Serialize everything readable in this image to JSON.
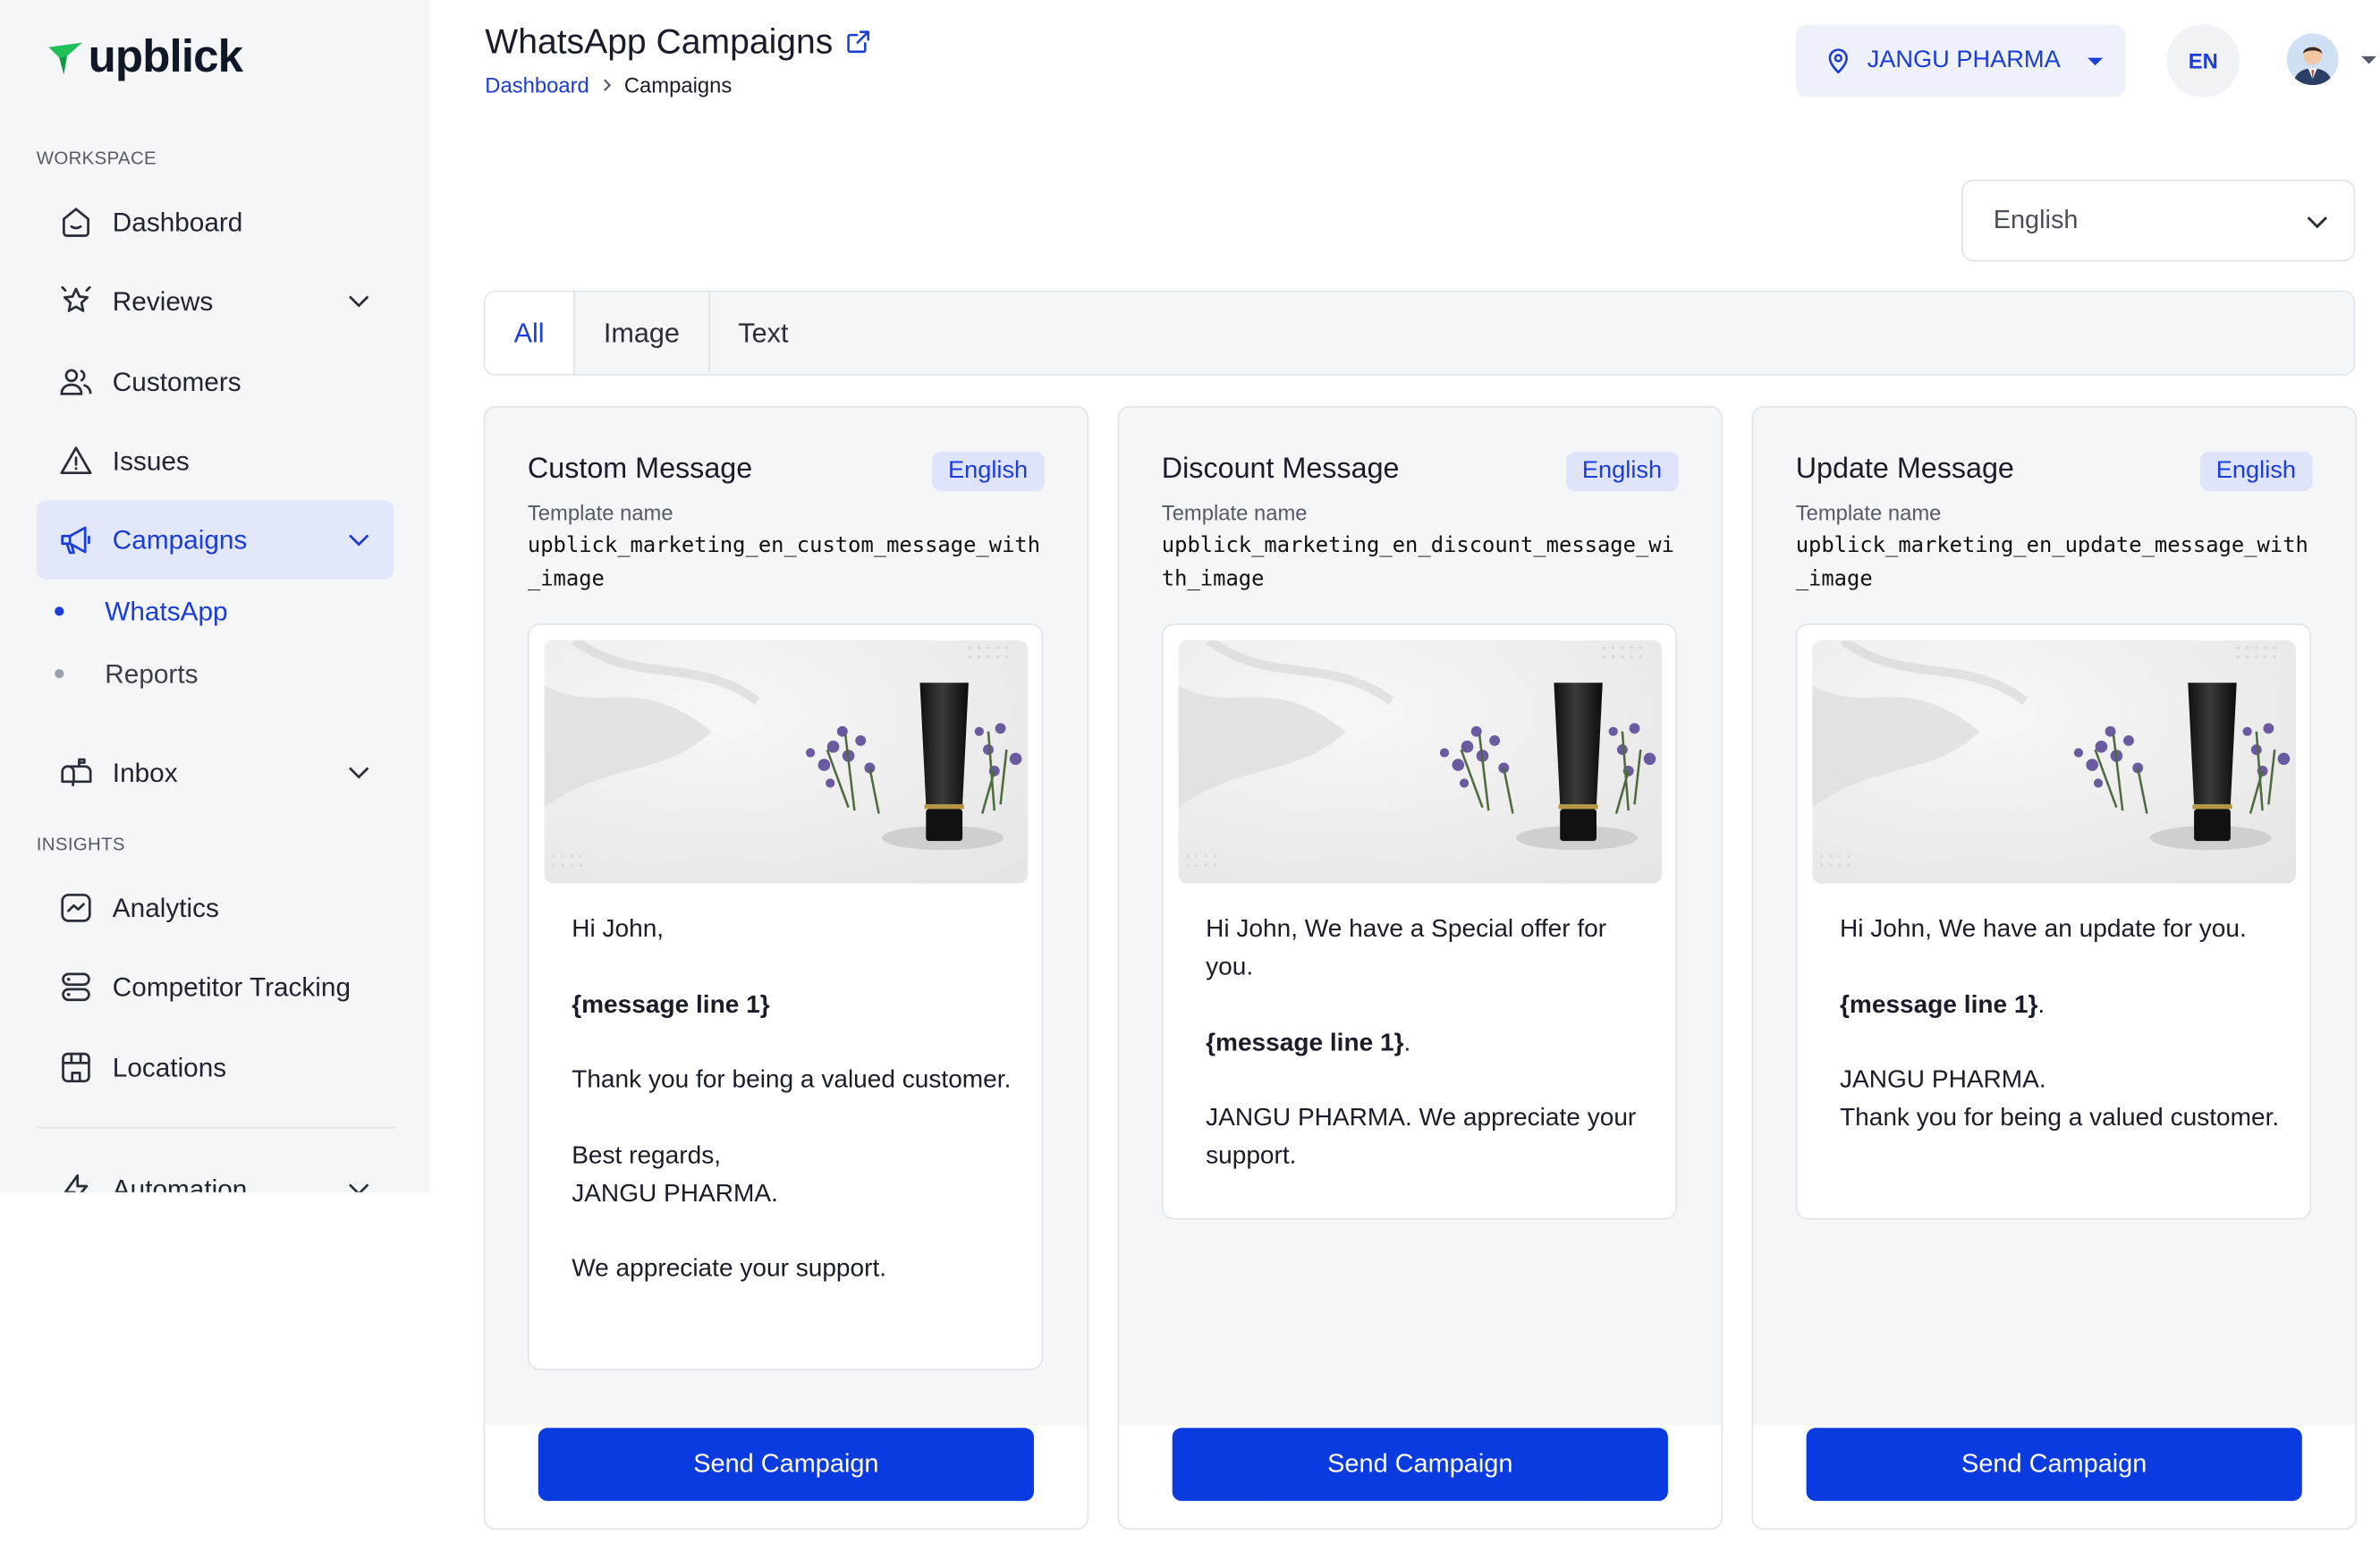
{
  "app": {
    "brand": "upblick"
  },
  "sidebar": {
    "workspace_label": "WORKSPACE",
    "insights_label": "INSIGHTS",
    "items": {
      "dashboard": "Dashboard",
      "reviews": "Reviews",
      "customers": "Customers",
      "issues": "Issues",
      "campaigns": "Campaigns",
      "whatsapp": "WhatsApp",
      "reports": "Reports",
      "inbox": "Inbox",
      "analytics": "Analytics",
      "competitor_tracking": "Competitor Tracking",
      "locations": "Locations",
      "automation": "Automation"
    },
    "active_item": "campaigns",
    "active_sub_item": "whatsapp"
  },
  "header": {
    "title": "WhatsApp Campaigns",
    "breadcrumb": {
      "root": "Dashboard",
      "current": "Campaigns"
    },
    "location": "JANGU PHARMA",
    "language_code": "EN"
  },
  "language_select": {
    "value": "English"
  },
  "tabs": {
    "all": "All",
    "image": "Image",
    "text": "Text",
    "active": "all"
  },
  "template_name_label": "Template name",
  "send_button_label": "Send Campaign",
  "templates": [
    {
      "title": "Custom Message",
      "language": "English",
      "template_name": "upblick_marketing_en_custom_message_with_image",
      "message": {
        "l1": "Hi John,",
        "l2": "{message line 1}",
        "l3": "Thank you for being a valued customer.",
        "l4a": "Best regards,",
        "l4b": "JANGU PHARMA.",
        "l5": "We appreciate your support."
      }
    },
    {
      "title": "Discount Message",
      "language": "English",
      "template_name": "upblick_marketing_en_discount_message_with_image",
      "message": {
        "l1": "Hi John, We have a Special offer for you.",
        "l2": "{message line 1}",
        "l2_suffix": ".",
        "l3": "JANGU PHARMA. We appreciate your support."
      }
    },
    {
      "title": "Update Message",
      "language": "English",
      "template_name": "upblick_marketing_en_update_message_with_image",
      "message": {
        "l1": "Hi John, We have an update for you.",
        "l2": "{message line 1}",
        "l2_suffix": ".",
        "l3a": "JANGU PHARMA.",
        "l3b": "Thank you for being a valued customer."
      }
    }
  ],
  "colors": {
    "accent": "#1a3cd8",
    "button": "#0a3be0",
    "sidebar_bg": "#f5f6f8",
    "active_bg": "#e3e7fa"
  },
  "icons": {
    "dashboard": "home-icon",
    "reviews": "star-icon",
    "customers": "users-icon",
    "issues": "warning-icon",
    "campaigns": "megaphone-icon",
    "inbox": "mailbox-icon",
    "analytics": "chart-icon",
    "competitor_tracking": "server-icon",
    "locations": "store-icon",
    "automation": "bolt-icon"
  }
}
